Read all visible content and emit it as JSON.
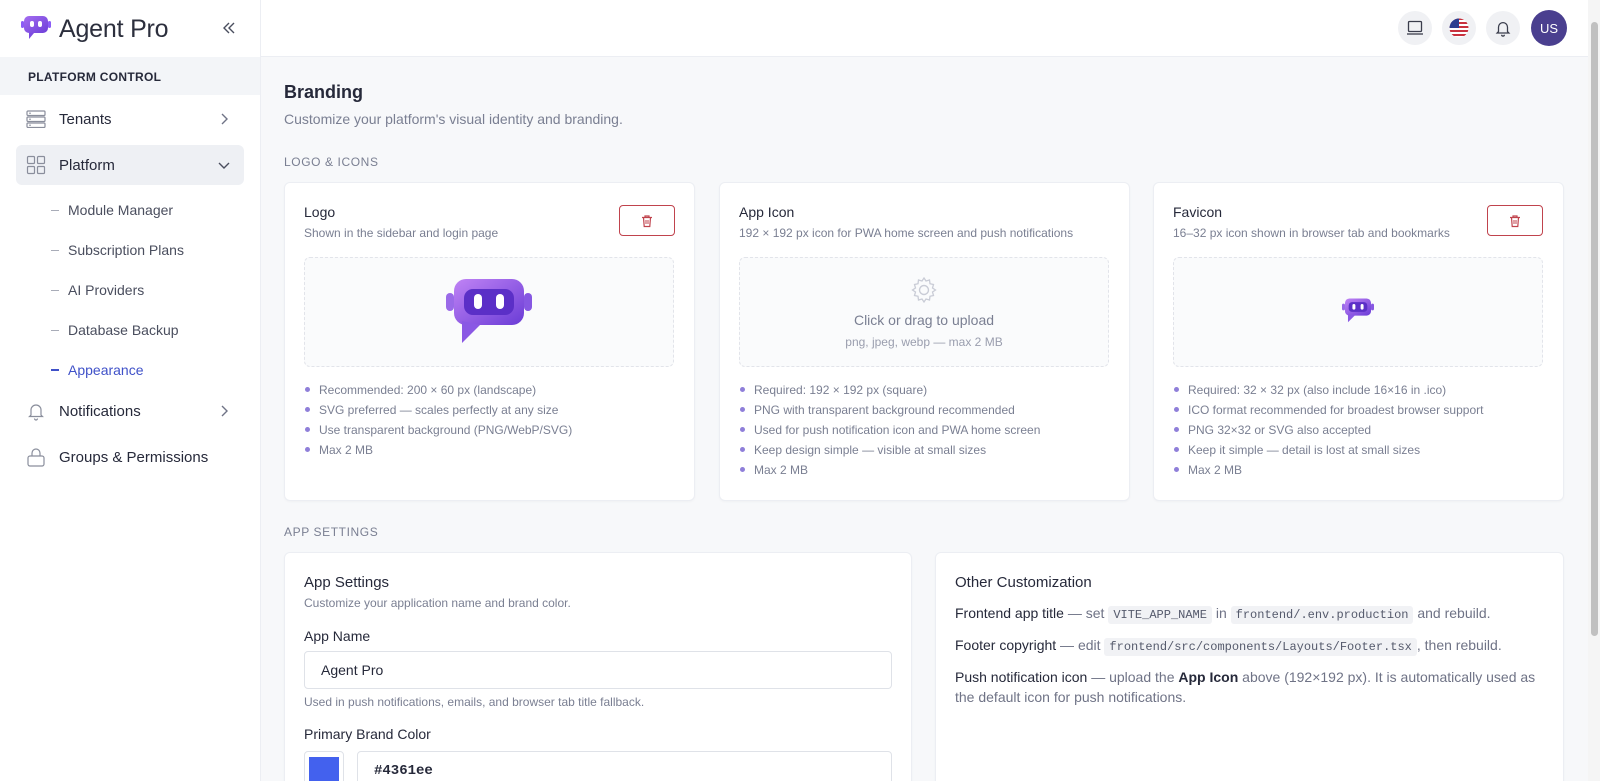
{
  "sidebar": {
    "brand": "Agent Pro",
    "section_title": "PLATFORM CONTROL",
    "items": {
      "tenants": "Tenants",
      "platform": "Platform",
      "notifications": "Notifications",
      "groups": "Groups & Permissions"
    },
    "platform_children": [
      "Module Manager",
      "Subscription Plans",
      "AI Providers",
      "Database Backup",
      "Appearance"
    ]
  },
  "topbar": {
    "avatar_initials": "US",
    "icons": [
      "laptop-icon",
      "us-flag-icon",
      "bell-icon"
    ]
  },
  "page": {
    "title": "Branding",
    "subtitle": "Customize your platform's visual identity and branding.",
    "section_logo": "LOGO & ICONS",
    "section_app": "APP SETTINGS"
  },
  "cards": {
    "logo": {
      "title": "Logo",
      "desc": "Shown in the sidebar and login page",
      "bullets": [
        "Recommended: 200 × 60 px (landscape)",
        "SVG preferred — scales perfectly at any size",
        "Use transparent background (PNG/WebP/SVG)",
        "Max 2 MB"
      ]
    },
    "appicon": {
      "title": "App Icon",
      "desc": "192 × 192 px icon for PWA home screen and push notifications",
      "upload_main": "Click or drag to upload",
      "upload_sub": "png, jpeg, webp — max 2 MB",
      "bullets": [
        "Required: 192 × 192 px (square)",
        "PNG with transparent background recommended",
        "Used for push notification icon and PWA home screen",
        "Keep design simple — visible at small sizes",
        "Max 2 MB"
      ]
    },
    "favicon": {
      "title": "Favicon",
      "desc": "16–32 px icon shown in browser tab and bookmarks",
      "bullets": [
        "Required: 32 × 32 px (also include 16×16 in .ico)",
        "ICO format recommended for broadest browser support",
        "PNG 32×32 or SVG also accepted",
        "Keep it simple — detail is lost at small sizes",
        "Max 2 MB"
      ]
    }
  },
  "app_settings": {
    "title": "App Settings",
    "desc": "Customize your application name and brand color.",
    "app_name_label": "App Name",
    "app_name_value": "Agent Pro",
    "app_name_help": "Used in push notifications, emails, and browser tab title fallback.",
    "brand_color_label": "Primary Brand Color",
    "brand_color_value": "#4361ee"
  },
  "other": {
    "title": "Other Customization",
    "l1_strong": "Frontend app title",
    "l1_a": " — set ",
    "l1_code1": "VITE_APP_NAME",
    "l1_b": " in ",
    "l1_code2": "frontend/.env.production",
    "l1_c": " and rebuild.",
    "l2_strong": "Footer copyright",
    "l2_a": " — edit ",
    "l2_code": "frontend/src/components/Layouts/Footer.tsx",
    "l2_b": ", then rebuild.",
    "l3_strong": "Push notification icon",
    "l3_a": " — upload the ",
    "l3_bold": "App Icon",
    "l3_b": " above (192×192 px). It is automatically used as the default icon for push notifications."
  },
  "colors": {
    "accent": "#3f51c8",
    "brand_purple": "#8b5cf6",
    "danger": "#c0434d",
    "swatch": "#4361ee"
  }
}
